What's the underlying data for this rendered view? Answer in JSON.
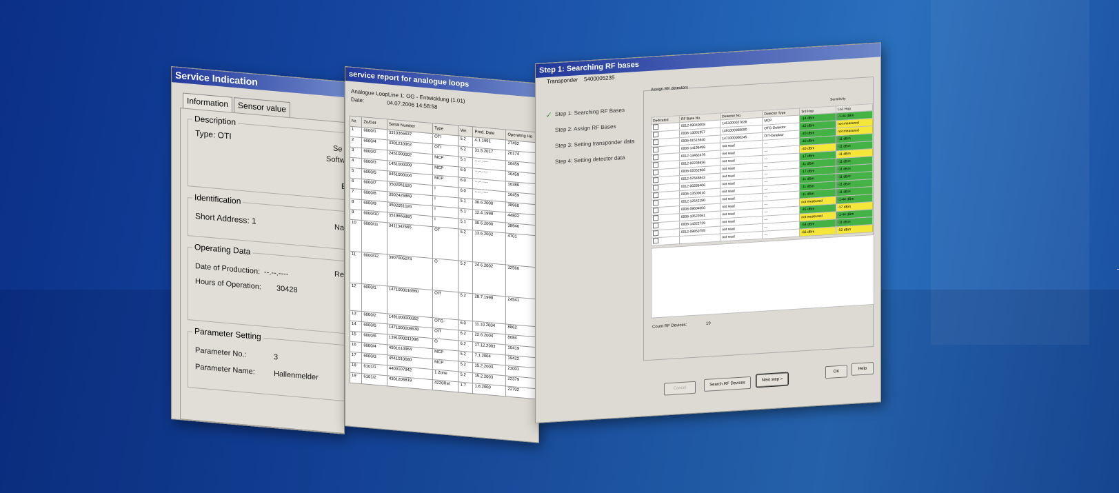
{
  "window1": {
    "title": "Service Indication",
    "tabs": [
      "Information",
      "Sensor value"
    ],
    "description_legend": "Description",
    "type_text": "Type: OTI",
    "clip_se": "Se",
    "clip_softw": "Softw",
    "clip_e": "E",
    "identification_legend": "Identification",
    "short_address": "Short Address: 1",
    "clip_na": "Na",
    "operating_legend": "Operating Data",
    "date_prod_label": "Date of Production:",
    "date_prod_value": "--.--.----",
    "hours_label": "Hours of Operation:",
    "hours_value": "30428",
    "clip_re": "Re",
    "param_legend": "Parameter Setting",
    "param_no_label": "Parameter No.:",
    "param_no_value": "3",
    "param_name_label": "Parameter Name:",
    "param_name_value": "Hallenmelder"
  },
  "window2": {
    "title": "service report for analogue loops",
    "header_line1": "Analogue LoopLine 1: OG - Entwicklung (1.01)",
    "date_label": "Date:",
    "date_value": "04.07.2006 14:58:58",
    "columns": [
      "Nr.",
      "Zo/Det",
      "Serial Number",
      "Type",
      "Ver.",
      "Prod. Date",
      "Operating Ho",
      "Pa"
    ],
    "rows": [
      [
        "1",
        "6000/1",
        "3310366637",
        "OTI",
        "5.2",
        "4.1.1991",
        "27492",
        "30"
      ],
      [
        "2",
        "6000/4",
        "3301210962",
        "OTI",
        "5.2",
        "31.5.2017",
        "26174",
        "30"
      ],
      [
        "3",
        "6000/2",
        "2451000002",
        "MCP",
        "5.1",
        "--.--.----",
        "16459",
        "4"
      ],
      [
        "4",
        "6000/3",
        "1451000009",
        "MCP",
        "6.0",
        "--.--.----",
        "16459",
        "4"
      ],
      [
        "5",
        "6000/5",
        "0451000004",
        "MCP",
        "6.0",
        "--.--.----",
        "16380",
        "4"
      ],
      [
        "6",
        "6000/7",
        "3502051620",
        "I",
        "6.0",
        "--.--.----",
        "16459",
        "4"
      ],
      [
        "7",
        "6000/8",
        "3502425869",
        "I",
        "5.1",
        "30.6.2000",
        "38960",
        "4"
      ],
      [
        "8",
        "6000/9",
        "3502051026",
        "I",
        "5.1",
        "12.4.1998",
        "44802",
        "4"
      ],
      [
        "9",
        "6000/10",
        "3519666865",
        "I",
        "5.1",
        "30.6.2000",
        "38946",
        "4"
      ],
      [
        "10",
        "6000/11",
        "3411342565",
        "OT",
        "5.2",
        "13.6.2002",
        "4701",
        "4"
      ],
      [
        "11",
        "6000/12",
        "3907005074",
        "O",
        "5.2",
        "24.6.2002",
        "32560",
        "4"
      ],
      [
        "12",
        "6000/1",
        "1471000016560",
        "OIT",
        "5.2",
        "28.7.1998",
        "24541",
        "4"
      ],
      [
        "13",
        "6000/2",
        "1491000000352",
        "OTG",
        "6.0",
        "11.10.2004",
        "8862",
        "4"
      ],
      [
        "14",
        "6000/5",
        "1471000008638",
        "OIT",
        "6.2",
        "22.6.2004",
        "8684",
        "4"
      ],
      [
        "15",
        "6000/6",
        "1391000011998",
        "O",
        "6.2",
        "17.12.2003",
        "10419",
        "4"
      ],
      [
        "16",
        "6000/4",
        "4501614964",
        "MCP",
        "5.2",
        "7.1.2004",
        "19422",
        "4"
      ],
      [
        "17",
        "6000/3",
        "4541010680",
        "MCP",
        "5.2",
        "15.2.2003",
        "23001",
        "4"
      ],
      [
        "18",
        "6101/1",
        "4400107942",
        "1 Zone",
        "5.2",
        "15.2.2003",
        "22379",
        "4"
      ],
      [
        "19",
        "6101/2",
        "4301205819",
        "4220Rel",
        "1.7",
        "1.8.2000",
        "22702",
        "4"
      ]
    ]
  },
  "window3": {
    "title": "Step 1: Searching RF bases",
    "transponder_label": "Transponder",
    "transponder_value": "5400005235",
    "steps": [
      "Step 1: Searching RF Bases",
      "Step 2: Assign RF Bases",
      "Step 3: Setting transponder data",
      "Step 4: Setting detector data"
    ],
    "assign_label": "Assign RF detectors",
    "sensitivity": "Sensitivity",
    "columns": [
      "Dedicated",
      "RF Base No.",
      "Detector No.",
      "Detector Type",
      "3rd Hop",
      "Lo1 Hop"
    ],
    "rows": [
      [
        "0012-09040008",
        "1451000027638",
        "MCP",
        "-14 dBm",
        "-1-44 dBm"
      ],
      [
        "0006-13001957",
        "1491000008090",
        "OTG-Detektor",
        "-42 dBm",
        "not measured"
      ],
      [
        "0006-01515640",
        "1471000000245",
        "OIT-Detektor",
        "-40 dBm",
        "not measured"
      ],
      [
        "0006-14196499",
        "not read",
        "---",
        "-40 dBm",
        "-11 dBm"
      ],
      [
        "0012-13462479",
        "not read",
        "---",
        "-40 dBm",
        "-11 dBm"
      ],
      [
        "0012-02238636",
        "not read",
        "---",
        "-17 dBm",
        "-11 dBm"
      ],
      [
        "0006-02052966",
        "not read",
        "---",
        "-11 dBm",
        "-11 dBm"
      ],
      [
        "0012-07648843",
        "not read",
        "---",
        "-17 dBm",
        "-11 dBm"
      ],
      [
        "0012-00286406",
        "not read",
        "---",
        "-11 dBm",
        "-11 dBm"
      ],
      [
        "0006-13500010",
        "not read",
        "---",
        "-11 dBm",
        "-11 dBm"
      ],
      [
        "0012-12542180",
        "not read",
        "---",
        "-11 dBm",
        "-11 dBm"
      ],
      [
        "0006-09604000",
        "not read",
        "---",
        "not measured",
        "-1-44 dBm"
      ],
      [
        "0006-10522061",
        "not read",
        "---",
        "-45 dBm",
        "-17 dBm"
      ],
      [
        "0006-14322729",
        "not read",
        "---",
        "not measured",
        "-1-44 dBm"
      ],
      [
        "0012-09850755",
        "not read",
        "---",
        "-54 dBm",
        "-11 dBm"
      ],
      [
        "",
        "not read",
        "---",
        "-66 dBm",
        "-52 dBm"
      ]
    ],
    "cell_colors": [
      [
        "g",
        "g"
      ],
      [
        "g",
        "y"
      ],
      [
        "g",
        "y"
      ],
      [
        "g",
        "g"
      ],
      [
        "y",
        "g"
      ],
      [
        "g",
        "y"
      ],
      [
        "g",
        "g"
      ],
      [
        "g",
        "g"
      ],
      [
        "g",
        "g"
      ],
      [
        "g",
        "g"
      ],
      [
        "g",
        "g"
      ],
      [
        "y",
        "g"
      ],
      [
        "g",
        "y"
      ],
      [
        "y",
        "g"
      ],
      [
        "g",
        "g"
      ],
      [
        "y",
        "y"
      ]
    ],
    "count_label": "Count RF Devices:",
    "count_value": "19",
    "btn_cancel": "Cancel",
    "btn_search": "Search RF Devices",
    "btn_next": "Next step >",
    "btn_ok": "OK",
    "btn_help": "Help"
  }
}
